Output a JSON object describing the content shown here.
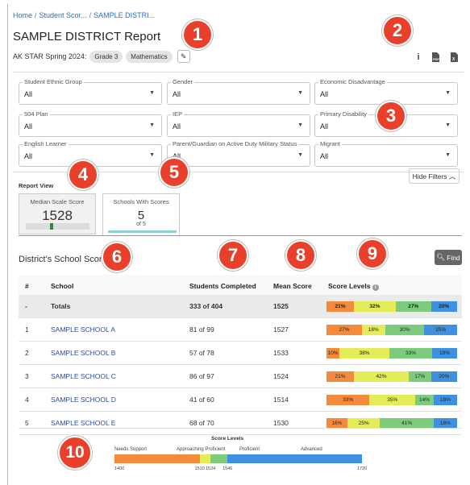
{
  "breadcrumb": [
    "Home",
    "Student Scor...",
    "SAMPLE DISTRI..."
  ],
  "page_title": "SAMPLE DISTRICT Report",
  "assessment": {
    "label": "AK STAR Spring 2024:",
    "grade": "Grade 3",
    "subject": "Mathematics"
  },
  "toolbar_icons": [
    "info-icon",
    "pdf-icon",
    "excel-icon"
  ],
  "filters": [
    {
      "label": "Student Ethnic Group",
      "value": "All"
    },
    {
      "label": "Gender",
      "value": "All"
    },
    {
      "label": "Economic Disadvantage",
      "value": "All"
    },
    {
      "label": "504 Plan",
      "value": "All"
    },
    {
      "label": "IEP",
      "value": "All"
    },
    {
      "label": "Primary Disability",
      "value": "All"
    },
    {
      "label": "English Learner",
      "value": "All"
    },
    {
      "label": "Parent/Guardian on Active Duty Military Status",
      "value": "All"
    },
    {
      "label": "Migrant",
      "value": "All"
    }
  ],
  "hide_filters_label": "Hide Filters",
  "report_view": {
    "label": "Report View",
    "median": {
      "title": "Median Scale Score",
      "value": "1528"
    },
    "schools": {
      "title": "Schools With Scores",
      "value": "5",
      "sub": "of 5"
    }
  },
  "section_title": "District's School Scores",
  "find_label": "Find",
  "table": {
    "headers": [
      "#",
      "School",
      "Students Completed",
      "Mean Score",
      "Score Levels"
    ],
    "rows": [
      {
        "num": "-",
        "school": "Totals",
        "completed": "333 of 404",
        "mean": "1525",
        "levels": [
          21,
          32,
          27,
          20
        ],
        "labels": [
          "21%",
          "32%",
          "27%",
          "20%"
        ]
      },
      {
        "num": "1",
        "school": "SAMPLE SCHOOL A",
        "completed": "81 of 99",
        "mean": "1527",
        "levels": [
          27,
          18,
          30,
          25
        ],
        "labels": [
          "27%",
          "18%",
          "30%",
          "25%"
        ]
      },
      {
        "num": "2",
        "school": "SAMPLE SCHOOL B",
        "completed": "57 of 78",
        "mean": "1533",
        "levels": [
          10,
          38,
          33,
          19
        ],
        "labels": [
          "10%",
          "38%",
          "33%",
          "19%"
        ]
      },
      {
        "num": "3",
        "school": "SAMPLE SCHOOL C",
        "completed": "86 of 97",
        "mean": "1524",
        "levels": [
          21,
          42,
          17,
          20
        ],
        "labels": [
          "21%",
          "42%",
          "17%",
          "20%"
        ]
      },
      {
        "num": "4",
        "school": "SAMPLE SCHOOL D",
        "completed": "41 of 60",
        "mean": "1514",
        "levels": [
          33,
          35,
          14,
          18
        ],
        "labels": [
          "33%",
          "35%",
          "14%",
          "18%"
        ]
      },
      {
        "num": "5",
        "school": "SAMPLE SCHOOL E",
        "completed": "68 of 70",
        "mean": "1530",
        "levels": [
          16,
          25,
          41,
          18
        ],
        "labels": [
          "16%",
          "25%",
          "41%",
          "18%"
        ]
      }
    ]
  },
  "legend": {
    "title": "Score Levels",
    "levels": [
      "Needs Support",
      "Approaching Proficient",
      "Proficient",
      "Advanced"
    ],
    "ticks": [
      "1400",
      "1510",
      "1524",
      "1546",
      "1720"
    ],
    "tick_values": [
      1400,
      1510,
      1524,
      1546,
      1720
    ]
  },
  "level_colors": [
    "#f58a3c",
    "#e4ec58",
    "#7dcc7d",
    "#3e90e0"
  ],
  "callouts": [
    "1",
    "2",
    "3",
    "4",
    "5",
    "6",
    "7",
    "8",
    "9",
    "10"
  ]
}
